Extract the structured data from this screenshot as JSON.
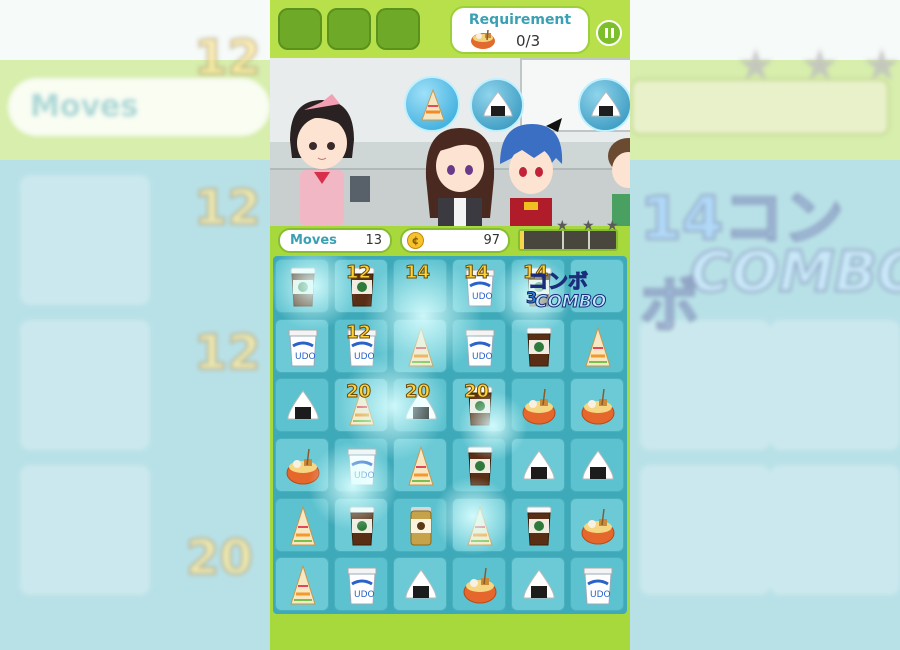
{
  "background": {
    "moves_label": "Moves",
    "moves_value": "13",
    "popup_scores": [
      "12",
      "12",
      "12",
      "20"
    ],
    "combo_jp": "14コンボ",
    "combo_en": "COMBO",
    "combo_count": "3"
  },
  "hud": {
    "requirement_title": "Requirement",
    "requirement_count": "0/3",
    "requirement_icon": "oden-bowl-icon",
    "booster_slots": 3,
    "pause_icon": "pause-icon"
  },
  "status": {
    "moves_label": "Moves",
    "moves_value": "13",
    "coin_icon": "coin-icon",
    "coin_symbol": "¢",
    "coins": "97",
    "score_progress": 0.04,
    "stars_earned": 0,
    "stars_total": 3
  },
  "customers": [
    {
      "name": "girl-pink-bow",
      "order": "sandwich-icon"
    },
    {
      "name": "boy-blue-hair",
      "order": "onigiri-icon"
    },
    {
      "name": "partial-customer",
      "order": "onigiri-icon"
    }
  ],
  "board": {
    "cols": 6,
    "rows": 6,
    "grid": [
      [
        "coffee",
        "coffee",
        "",
        "noodle",
        "coffee",
        ""
      ],
      [
        "noodle",
        "noodle",
        "sandwich",
        "noodle",
        "coffee",
        "sandwich"
      ],
      [
        "onigiri",
        "sandwich",
        "onigiri",
        "coffee",
        "oden",
        "oden"
      ],
      [
        "oden",
        "noodle",
        "sandwich",
        "coffee",
        "onigiri",
        "onigiri"
      ],
      [
        "sandwich",
        "coffee",
        "can-coffee",
        "sandwich",
        "coffee",
        "oden"
      ],
      [
        "sandwich",
        "noodle",
        "onigiri",
        "oden",
        "onigiri",
        "noodle"
      ]
    ],
    "popups": [
      {
        "text": "12",
        "cell": [
          1,
          0
        ]
      },
      {
        "text": "14",
        "cell": [
          2,
          0
        ]
      },
      {
        "text": "14",
        "cell": [
          3,
          0
        ]
      },
      {
        "text": "14",
        "cell": [
          4,
          0
        ]
      },
      {
        "text": "12",
        "cell": [
          1,
          1
        ]
      },
      {
        "text": "20",
        "cell": [
          1,
          2
        ]
      },
      {
        "text": "20",
        "cell": [
          2,
          2
        ]
      },
      {
        "text": "20",
        "cell": [
          3,
          2
        ]
      },
      {
        "text": "12",
        "cell": [
          1,
          -1
        ]
      }
    ],
    "combo_jp": "コンボ",
    "combo_en": "COMBO",
    "combo_count": "3"
  },
  "colors": {
    "frame_green": "#a8d93c",
    "board_blue": "#3ea9b9",
    "accent_teal": "#3aa0b4",
    "score_gold": "#ffd23a"
  }
}
